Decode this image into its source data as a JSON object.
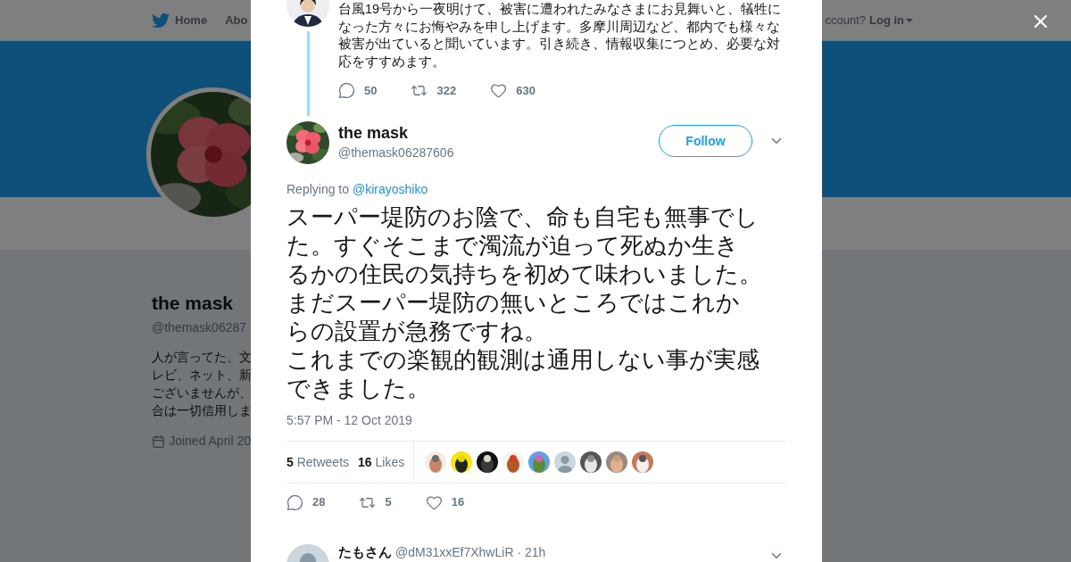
{
  "background_page": {
    "nav": {
      "items": [
        {
          "label": "Home"
        },
        {
          "label": "Abo"
        }
      ],
      "account_prompt": "ccount?",
      "login": "Log in"
    },
    "profile": {
      "name": "the mask",
      "handle": "@themask06287",
      "bio_lines": [
        "人が言ってた、文",
        "レビ、ネット、新",
        "ございませんが、",
        "合は一切信用しま"
      ],
      "joined": "Joined April 20"
    }
  },
  "dialog": {
    "previous_tweet": {
      "text": "台風19号から一夜明けて、被害に遭われたみなさまにお見舞いと、犠牲になった方々にお悔やみを申し上げます。多摩川周辺など、都内でも様々な被害が出ていると聞いています。引き続き、情報収集につとめ、必要な対応をすすめます。",
      "replies": "50",
      "retweets": "322",
      "likes": "630"
    },
    "tweet": {
      "name": "the mask",
      "handle": "@themask06287606",
      "follow": "Follow",
      "replying_prefix": "Replying to",
      "reply_to": "@kirayoshiko",
      "paragraphs": [
        "スーパー堤防のお陰で、命も自宅も無事でした。すぐそこまで濁流が迫って死ぬか生きるかの住民の気持ちを初めて味わいました。まだスーパー堤防の無いところではこれからの設置が急務ですね。",
        "これまでの楽観的観測は通用しない事が実感できました。"
      ],
      "timestamp": "5:57 PM - 12 Oct 2019",
      "retweet_count": "5",
      "retweet_label": "Retweets",
      "like_count": "16",
      "like_label": "Likes",
      "liker_avatars": [
        {
          "kind": "picture"
        },
        {
          "kind": "picture"
        },
        {
          "kind": "picture"
        },
        {
          "kind": "picture"
        },
        {
          "kind": "picture"
        },
        {
          "kind": "default"
        },
        {
          "kind": "picture"
        },
        {
          "kind": "picture"
        },
        {
          "kind": "picture"
        }
      ],
      "replies": "28",
      "retweets": "5",
      "likes": "16"
    },
    "next_reply": {
      "name": "たもさん",
      "handle": "@dM31xxEf7XhwLiR",
      "time": "· 21h"
    }
  }
}
